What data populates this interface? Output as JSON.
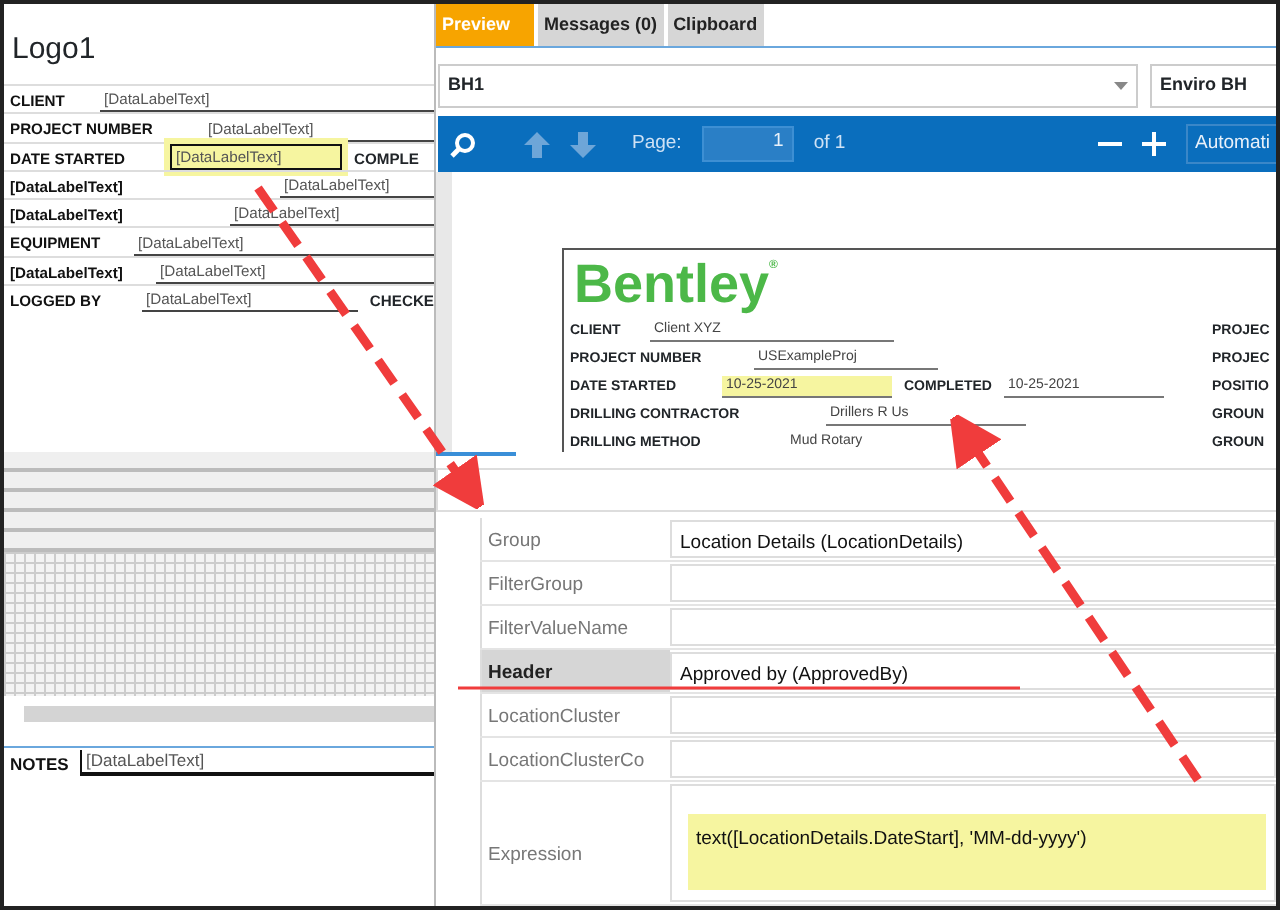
{
  "designer": {
    "logo_text": "Logo1",
    "fields": [
      {
        "label": "CLIENT",
        "value": "[DataLabelText]",
        "selected": false
      },
      {
        "label": "PROJECT NUMBER",
        "value": "[DataLabelText]",
        "selected": false
      },
      {
        "label": "DATE STARTED",
        "value": "[DataLabelText]",
        "selected": true,
        "extra_label": "COMPLE"
      },
      {
        "label": "[DataLabelText]",
        "value": "[DataLabelText]",
        "selected": false
      },
      {
        "label": "[DataLabelText]",
        "value": "[DataLabelText]",
        "selected": false
      },
      {
        "label": "EQUIPMENT",
        "value": "[DataLabelText]",
        "selected": false
      },
      {
        "label": "[DataLabelText]",
        "value": "[DataLabelText]",
        "selected": false
      },
      {
        "label": "LOGGED BY",
        "value": "[DataLabelText]",
        "selected": false,
        "extra_label": "CHECKE"
      }
    ],
    "notes": {
      "label": "NOTES",
      "value": "[DataLabelText]"
    }
  },
  "tabs": [
    {
      "label": "Preview",
      "selected": true
    },
    {
      "label": "Messages (0)",
      "selected": false
    },
    {
      "label": "Clipboard",
      "selected": false
    }
  ],
  "selectors": {
    "borehole": "BH1",
    "template": "Enviro BH"
  },
  "toolbar": {
    "page_label": "Page:",
    "page": "1",
    "page_total": "of 1",
    "zoom": "Automati"
  },
  "preview": {
    "logo_text": "Bentley$^{®}$",
    "rows": [
      {
        "label": "CLIENT",
        "value": "Client XYZ",
        "highlighted": false,
        "side_label": "PROJEC"
      },
      {
        "label": "PROJECT NUMBER",
        "value": "USExampleProj",
        "highlighted": false,
        "side_label": "PROJEC"
      },
      {
        "label": "DATE STARTED",
        "value": "10-25-2021",
        "highlighted": true,
        "extra_label": "COMPLETED",
        "extra_value": "10-25-2021",
        "side_label": "POSITIO"
      },
      {
        "label": "DRILLING CONTRACTOR",
        "value": "Drillers R Us",
        "highlighted": false,
        "side_label": "GROUN"
      },
      {
        "label": "DRILLING METHOD",
        "value": "Mud Rotary",
        "highlighted": false,
        "side_label": "GROUN"
      }
    ]
  },
  "properties": [
    {
      "name": "Group",
      "value": "Location Details (LocationDetails)",
      "selected": false,
      "highlighted": false
    },
    {
      "name": "FilterGroup",
      "selected": false,
      "highlighted": false
    },
    {
      "name": "FilterValueName",
      "selected": false,
      "highlighted": false
    },
    {
      "name": "Header",
      "value": "Approved by (ApprovedBy)",
      "selected": true,
      "highlighted": false
    },
    {
      "name": "LocationCluster",
      "selected": false,
      "highlighted": false
    },
    {
      "name": "LocationClusterCo",
      "selected": false,
      "highlighted": false
    },
    {
      "name": "Expression",
      "value": "text([LocationDetails.DateStart], 'MM-dd-yyyy')",
      "selected": false,
      "highlighted": true
    }
  ]
}
